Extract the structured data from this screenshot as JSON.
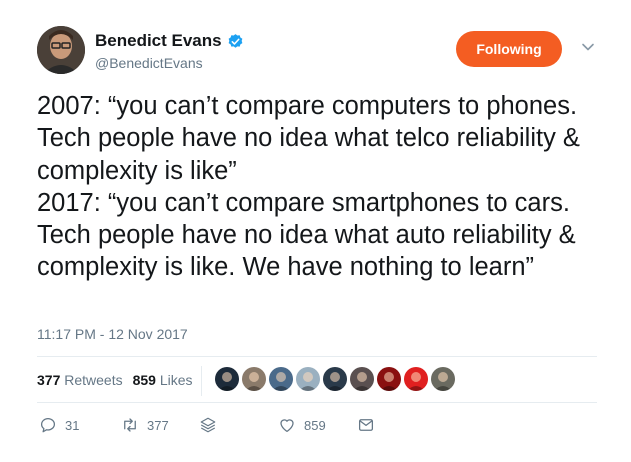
{
  "author": {
    "name": "Benedict Evans",
    "handle": "@BenedictEvans",
    "verified": true,
    "avatar_icon": "avatar-photo"
  },
  "follow_button": {
    "label": "Following",
    "color": "#f45d22"
  },
  "tweet": {
    "text": "2007: “you can’t compare computers to phones. Tech people have no idea what telco reliability & complexity is like”\n2017: “you can’t compare smartphones to cars. Tech people have no idea what auto reliability & complexity is like. We have nothing to learn”",
    "timestamp": "11:17 PM - 12 Nov 2017"
  },
  "stats": {
    "retweets_count": "377",
    "retweets_label": "Retweets",
    "likes_count": "859",
    "likes_label": "Likes"
  },
  "liker_avatars": [
    "#1d2b3a",
    "#8a7a6a",
    "#4a6a8a",
    "#9ab0c0",
    "#2a3a4a",
    "#5a5050",
    "#8a1010",
    "#e02020",
    "#6a6a60"
  ],
  "actions": {
    "reply_count": "31",
    "retweet_count": "377",
    "like_count": "859"
  },
  "colors": {
    "accent": "#f45d22",
    "verified": "#1da1f2",
    "secondary_text": "#657786"
  }
}
